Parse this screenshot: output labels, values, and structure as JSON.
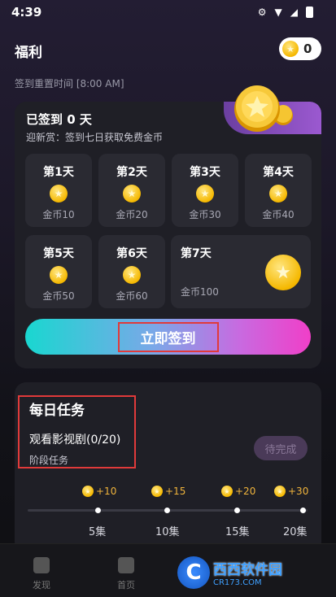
{
  "status_bar": {
    "time": "4:39"
  },
  "header": {
    "title": "福利",
    "coin_balance": "0"
  },
  "signin": {
    "reset_time": "签到重置时间 [8:00 AM]",
    "signed_days": "已签到 0 天",
    "newcomer_text": "迎新赏：签到七日获取免费金币",
    "days": [
      {
        "label": "第1天",
        "reward": "金币10"
      },
      {
        "label": "第2天",
        "reward": "金币20"
      },
      {
        "label": "第3天",
        "reward": "金币30"
      },
      {
        "label": "第4天",
        "reward": "金币40"
      },
      {
        "label": "第5天",
        "reward": "金币50"
      },
      {
        "label": "第6天",
        "reward": "金币60"
      },
      {
        "label": "第7天",
        "reward": "金币100"
      }
    ],
    "button_label": "立即签到"
  },
  "tasks": {
    "title": "每日任务",
    "task_name": "观看影视剧(0/20)",
    "stage_label": "阶段任务",
    "pending_button": "待完成",
    "milestones": [
      {
        "reward": "+10",
        "label": "5集"
      },
      {
        "reward": "+15",
        "label": "10集"
      },
      {
        "reward": "+20",
        "label": "15集"
      },
      {
        "reward": "+30",
        "label": "20集"
      }
    ]
  },
  "tab_bar": {
    "items": [
      {
        "label": "发现"
      },
      {
        "label": "首页"
      }
    ]
  },
  "watermark": {
    "main": "西西软件园",
    "sub": "CR173.COM",
    "logo": "C"
  },
  "colors": {
    "accent_gold": "#f5b800",
    "highlight_red": "#e03a3a",
    "gradient_start": "#19d7d0",
    "gradient_end": "#f03fc8"
  }
}
